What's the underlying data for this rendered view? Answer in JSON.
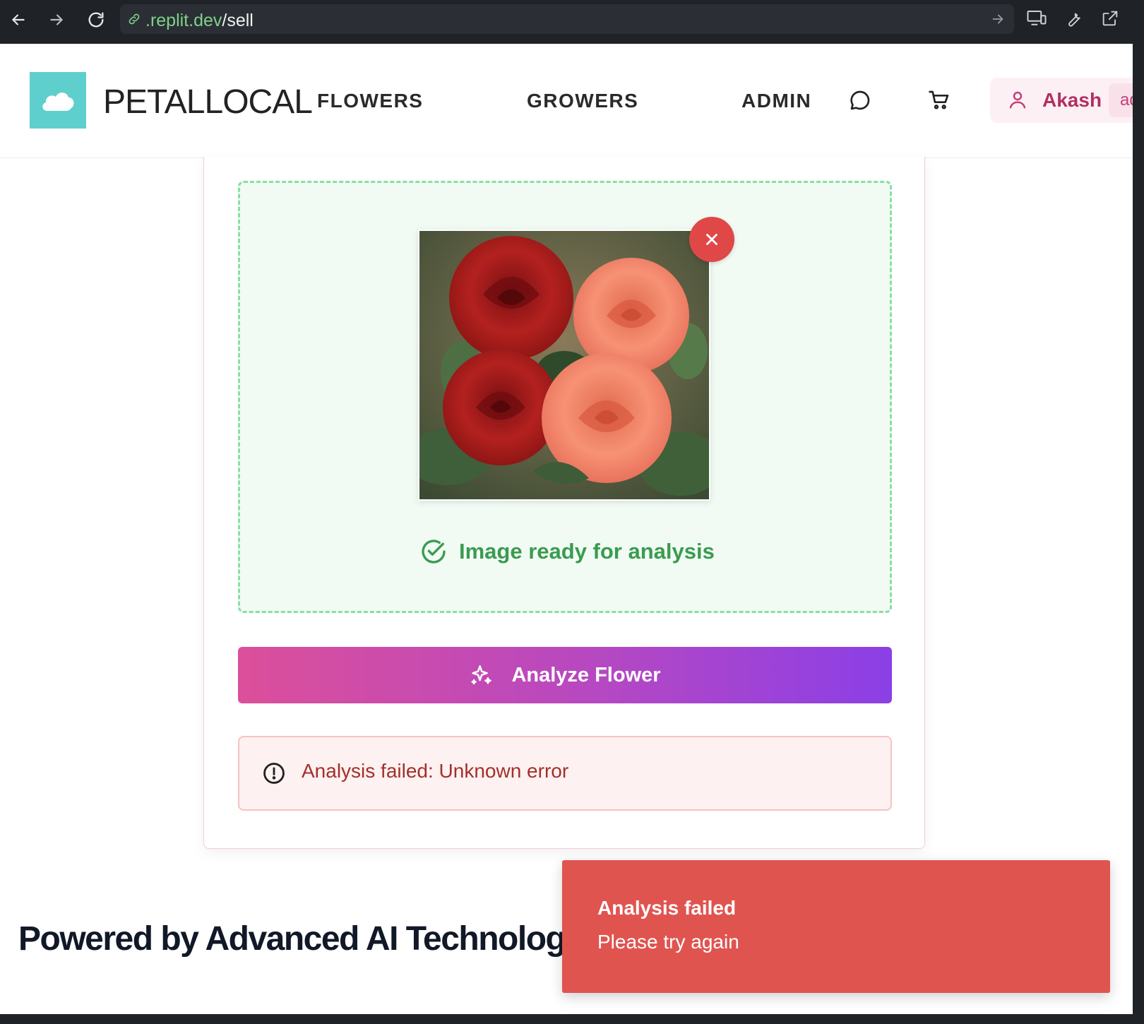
{
  "browser": {
    "url_domain": ".replit.dev",
    "url_path": "/sell"
  },
  "header": {
    "brand": "PETALLOCAL",
    "nav": {
      "flowers": "FLOWERS",
      "growers": "GROWERS",
      "admin": "ADMIN"
    },
    "user": {
      "name": "Akash",
      "role": "admin"
    }
  },
  "upload": {
    "status": "Image ready for analysis",
    "image_alt": "Roses"
  },
  "analyze_button": {
    "label": "Analyze Flower"
  },
  "error": {
    "message": "Analysis failed: Unknown error"
  },
  "section": {
    "title": "Powered by Advanced AI Technology"
  },
  "toast": {
    "title": "Analysis failed",
    "description": "Please try again"
  },
  "colors": {
    "logo_bg": "#5fcfcd",
    "dropzone_border": "#86e0a3",
    "success_green": "#3a9b4f",
    "button_gradient_start": "#dc4f9a",
    "button_gradient_end": "#8b3fe6",
    "error_red": "#e05450",
    "user_accent": "#b03062"
  },
  "icons": {
    "back": "arrow-left-icon",
    "forward": "arrow-right-icon",
    "reload": "reload-icon",
    "link": "link-icon",
    "chat": "chat-icon",
    "cart": "cart-icon",
    "user": "user-icon",
    "remove": "close-icon",
    "check": "check-circle-icon",
    "sparkle": "sparkle-icon",
    "alert": "alert-circle-icon"
  }
}
